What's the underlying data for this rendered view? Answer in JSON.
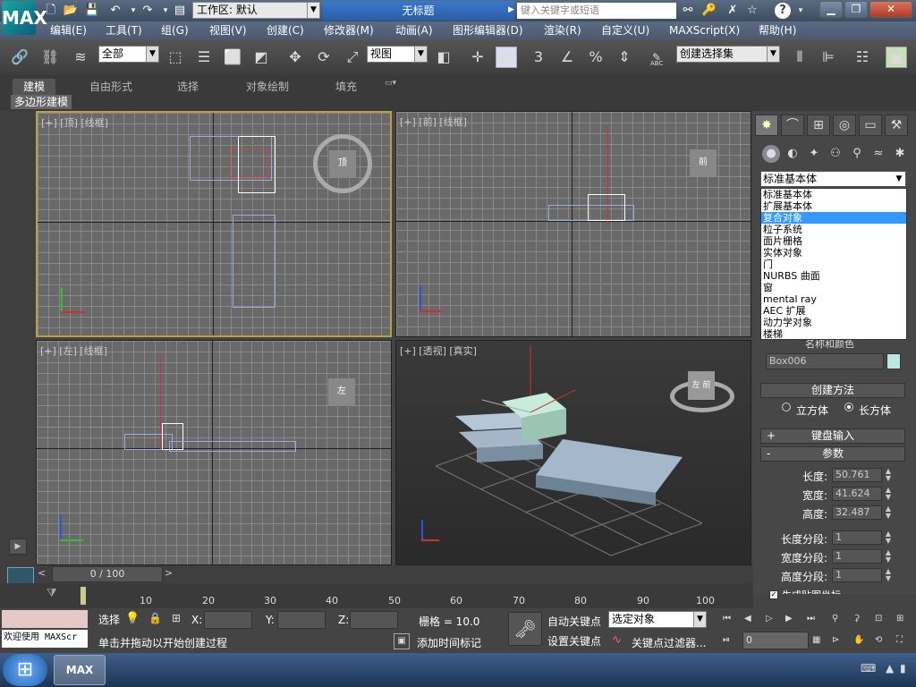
{
  "app": {
    "logo": "MAX",
    "title": "无标题"
  },
  "workspace": {
    "label": "工作区: 默认"
  },
  "search": {
    "placeholder": "键入关键字或短语"
  },
  "menus": [
    "编辑(E)",
    "工具(T)",
    "组(G)",
    "视图(V)",
    "创建(C)",
    "修改器(M)",
    "动画(A)",
    "图形编辑器(D)",
    "渲染(R)",
    "自定义(U)",
    "MAXScript(X)",
    "帮助(H)"
  ],
  "toolbar": {
    "filter": "全部",
    "refcoord": "视图",
    "numeric": "3",
    "selection_set": "创建选择集",
    "abc": "ABC"
  },
  "ribbon": {
    "tabs": [
      "建模",
      "自由形式",
      "选择",
      "对象绘制",
      "填充"
    ],
    "sub_label": "多边形建模"
  },
  "viewports": {
    "top": {
      "label": "[+] [顶] [线框]",
      "cube": "顶"
    },
    "front": {
      "label": "[+] [前] [线框]",
      "cube": "前"
    },
    "left": {
      "label": "[+] [左] [线框]",
      "cube": "左"
    },
    "persp": {
      "label": "[+] [透视] [真实]",
      "cube": "左 前"
    }
  },
  "axes": {
    "x": "x",
    "y": "y",
    "z": "z"
  },
  "command_panel": {
    "category_selected": "标准基本体",
    "category_options": [
      "标准基本体",
      "扩展基本体",
      "复合对象",
      "粒子系统",
      "面片栅格",
      "实体对象",
      "门",
      "NURBS 曲面",
      "窗",
      "mental ray",
      "AEC 扩展",
      "动力学对象",
      "楼梯"
    ],
    "highlighted_option": "复合对象",
    "name_color_title": "名称和颜色",
    "object_name": "Box006",
    "object_color": "#b8e8e0",
    "creation_method": {
      "title": "创建方法",
      "cube": "立方体",
      "box": "长方体",
      "selected": "长方体"
    },
    "keyboard_entry": {
      "title": "键盘输入",
      "toggle": "+"
    },
    "parameters": {
      "title": "参数",
      "toggle": "-",
      "length_label": "长度:",
      "length": "50.761",
      "width_label": "宽度:",
      "width": "41.624",
      "height_label": "高度:",
      "height": "32.487",
      "length_segs_label": "长度分段:",
      "length_segs": "1",
      "width_segs_label": "宽度分段:",
      "width_segs": "1",
      "height_segs_label": "高度分段:",
      "height_segs": "1",
      "gen_mapping_label": "生成贴图坐标"
    }
  },
  "timeline": {
    "position": "0 / 100",
    "ticks": [
      "10",
      "20",
      "30",
      "40",
      "50",
      "60",
      "70",
      "80",
      "90",
      "100"
    ]
  },
  "status": {
    "welcome": "欢迎使用 MAXScr",
    "selected_label": "选择",
    "prompt": "单击并拖动以开始创建过程",
    "x_label": "X:",
    "y_label": "Y:",
    "z_label": "Z:",
    "grid": "栅格 = 10.0",
    "add_time_tag": "添加时间标记",
    "auto_key": "自动关键点",
    "set_key": "设置关键点",
    "key_filter_select": "选定对象",
    "key_filters": "关键点过滤器...",
    "frame": "0"
  },
  "accent_colors": {
    "title_active": "#2a5ea8",
    "highlight": "#3399ff",
    "active_viewport": "#b59f48",
    "axis_x": "#d03030",
    "axis_y": "#30c030",
    "axis_z": "#3050e0"
  }
}
